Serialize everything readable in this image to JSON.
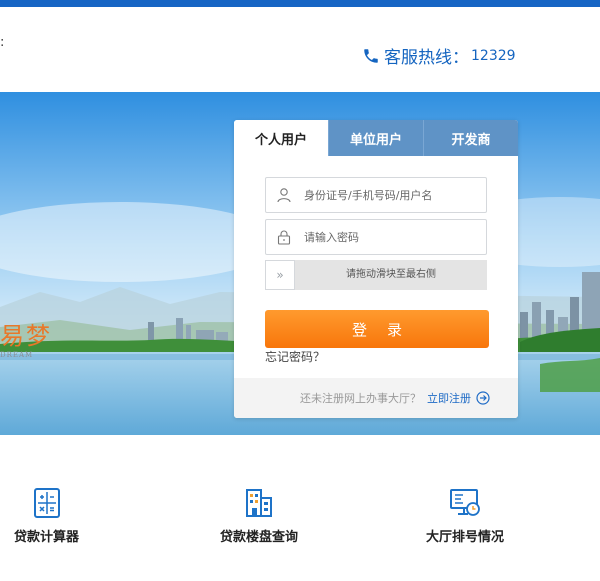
{
  "header": {
    "edge_text": ":",
    "hotline_label": "客服热线",
    "hotline_sep": "：",
    "hotline_number": "12329"
  },
  "banner": {
    "slogan": "易梦",
    "slogan_en": "DREAM"
  },
  "login": {
    "tabs": [
      {
        "label": "个人用户",
        "active": true
      },
      {
        "label": "单位用户",
        "active": false
      },
      {
        "label": "开发商",
        "active": false
      }
    ],
    "username_placeholder": "身份证号/手机号码/用户名",
    "password_placeholder": "请输入密码",
    "slider_text": "请拖动滑块至最右侧",
    "slider_handle": "»",
    "submit_label": "登录",
    "forgot_label": "忘记密码？",
    "register_prompt": "还未注册网上办事大厅？",
    "register_link": "立即注册"
  },
  "services": [
    {
      "label": "贷款计算器",
      "icon": "calculator-icon"
    },
    {
      "label": "贷款楼盘查询",
      "icon": "building-icon"
    },
    {
      "label": "大厅排号情况",
      "icon": "queue-screen-icon"
    }
  ],
  "colors": {
    "brand_blue": "#1665c4",
    "tab_blue": "#5f93c6",
    "accent_orange": "#f8760b",
    "link_blue": "#1e6bc6"
  }
}
